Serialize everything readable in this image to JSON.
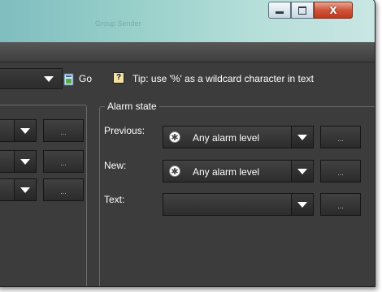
{
  "window": {
    "title": "Group Sender",
    "controls": {
      "minimize_icon": "minimize-icon",
      "maximize_icon": "maximize-icon",
      "close_icon": "close-icon",
      "close_glyph": "X"
    }
  },
  "toolbar": {
    "go_label": "Go",
    "go_icon": "go-icon",
    "tip_icon_glyph": "?",
    "tip_text": "Tip: use '%' as a wildcard character in text"
  },
  "left_panel": {
    "rows": [
      {
        "more_label": "..."
      },
      {
        "more_label": "..."
      },
      {
        "more_label": "..."
      }
    ]
  },
  "alarm_state": {
    "legend": "Alarm state",
    "rows": [
      {
        "label": "Previous:",
        "value": "Any alarm level",
        "icon": "asterisk-alarm-icon",
        "icon_glyph": "✱",
        "more_label": "..."
      },
      {
        "label": "New:",
        "value": "Any alarm level",
        "icon": "asterisk-alarm-icon",
        "icon_glyph": "✱",
        "more_label": "..."
      },
      {
        "label": "Text:",
        "value": "",
        "more_label": "..."
      }
    ]
  },
  "colors": {
    "background": "#3c3c3c",
    "title_gradient_start": "#7fbdc0",
    "close_button": "#c0381d"
  }
}
